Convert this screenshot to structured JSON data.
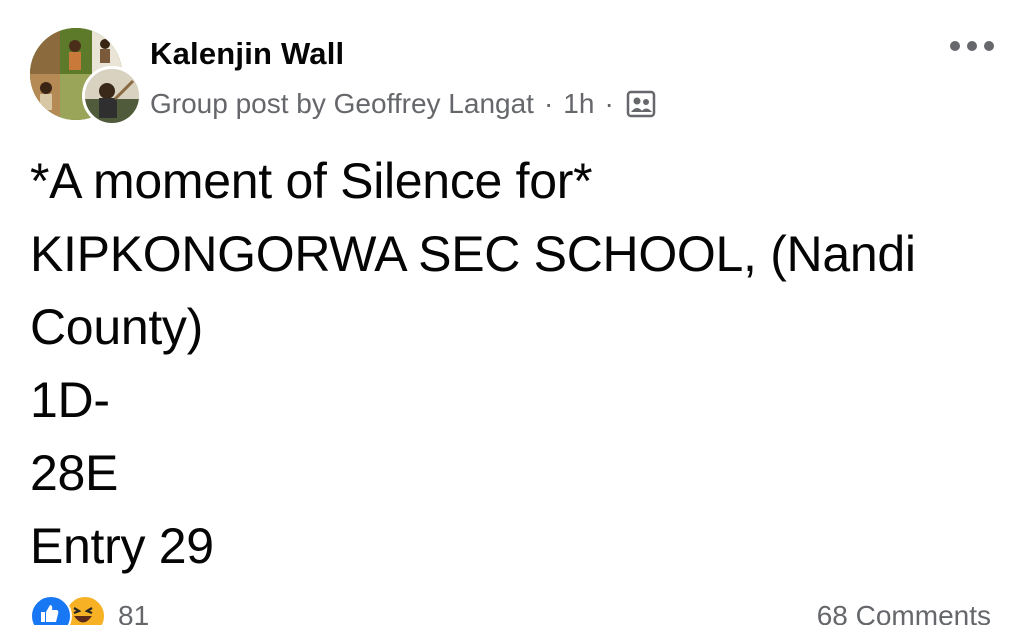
{
  "header": {
    "group_name": "Kalenjin Wall",
    "author_line": "Group post by Geoffrey Langat",
    "separator": "·",
    "time": "1h",
    "audience_icon": "members-icon",
    "more_icon": "more-horizontal-icon"
  },
  "post": {
    "lines": [
      "*A moment of Silence for*",
      "KIPKONGORWA SEC SCHOOL, (Nandi",
      "County)",
      "1D-",
      "28E",
      "Entry 29"
    ]
  },
  "footer": {
    "reaction_icons": [
      "like-icon",
      "haha-icon"
    ],
    "reaction_count": "81",
    "comments": "68 Comments"
  },
  "colors": {
    "text_primary": "#050505",
    "text_secondary": "#65676b",
    "like_blue": "#1877f2",
    "haha_yellow": "#f7b125"
  }
}
